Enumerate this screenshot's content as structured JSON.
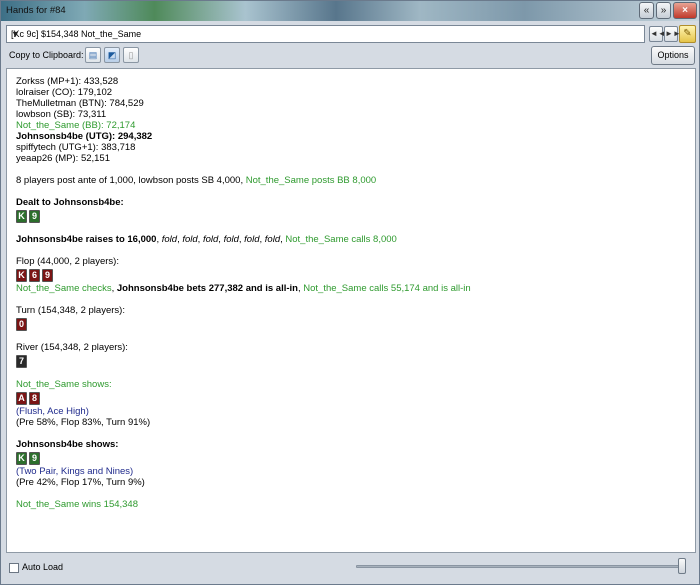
{
  "window": {
    "title": "Hands for #84",
    "buttons": {
      "prev": "«",
      "next": "»",
      "close": "×"
    }
  },
  "selector": {
    "value": "[Kc 9c] $154,348 Not_the_Same",
    "prev_label": "◄◄",
    "next_label": "►►",
    "tag_icon": "tag-icon"
  },
  "toolbar": {
    "copy_label": "Copy to Clipboard:",
    "options_label": "Options"
  },
  "colors": {
    "hero": "#2e9a2e",
    "hand_desc": "#1f2a8c"
  },
  "hand": {
    "players": [
      {
        "text": "Zorkss (MP+1): 433,528",
        "style": "normal"
      },
      {
        "text": "lolraiser (CO): 179,102",
        "style": "normal"
      },
      {
        "text": "TheMulletman (BTN): 784,529",
        "style": "normal"
      },
      {
        "text": "lowbson (SB): 73,311",
        "style": "normal"
      },
      {
        "text": "Not_the_Same (BB): 72,174",
        "style": "hero"
      },
      {
        "text": "Johnsonsb4be (UTG): 294,382",
        "style": "bold"
      },
      {
        "text": "spiffytech (UTG+1): 383,718",
        "style": "normal"
      },
      {
        "text": "yeaap26 (MP): 52,151",
        "style": "normal"
      }
    ],
    "posts": {
      "text": "8 players post ante of 1,000, lowbson posts SB 4,000, ",
      "hero_text": "Not_the_Same posts BB 8,000"
    },
    "dealt": {
      "label": "Dealt to Johnsonsb4be:",
      "cards": [
        {
          "rank": "K",
          "suit": "c"
        },
        {
          "rank": "9",
          "suit": "c"
        }
      ]
    },
    "preflop": {
      "raise": "Johnsonsb4be raises to 16,000",
      "sep": ", ",
      "folds": [
        "fold",
        "fold",
        "fold",
        "fold",
        "fold",
        "fold"
      ],
      "call": "Not_the_Same calls 8,000"
    },
    "flop": {
      "label": "Flop (44,000, 2 players):",
      "cards": [
        {
          "rank": "K",
          "suit": "h"
        },
        {
          "rank": "6",
          "suit": "h"
        },
        {
          "rank": "9",
          "suit": "h"
        }
      ],
      "check": "Not_the_Same checks",
      "bet": "Johnsonsb4be bets 277,382 and is all-in",
      "call": "Not_the_Same calls 55,174 and is all-in"
    },
    "turn": {
      "label": "Turn (154,348, 2 players):",
      "cards": [
        {
          "rank": "0",
          "suit": "h"
        }
      ]
    },
    "river": {
      "label": "River (154,348, 2 players):",
      "cards": [
        {
          "rank": "7",
          "suit": "s"
        }
      ]
    },
    "showdown": [
      {
        "label": "Not_the_Same shows:",
        "style": "hero",
        "cards": [
          {
            "rank": "A",
            "suit": "h"
          },
          {
            "rank": "8",
            "suit": "h"
          }
        ],
        "desc": "(Flush, Ace High)",
        "equity": "(Pre 58%, Flop 83%, Turn 91%)"
      },
      {
        "label": "Johnsonsb4be shows:",
        "style": "bold",
        "cards": [
          {
            "rank": "K",
            "suit": "c"
          },
          {
            "rank": "9",
            "suit": "c"
          }
        ],
        "desc": "(Two Pair, Kings and Nines)",
        "equity": "(Pre 42%, Flop 17%, Turn 9%)"
      }
    ],
    "result": "Not_the_Same wins 154,348"
  },
  "footer": {
    "auto_load_label": "Auto Load",
    "auto_load_checked": false,
    "slider_value": 1.0
  }
}
